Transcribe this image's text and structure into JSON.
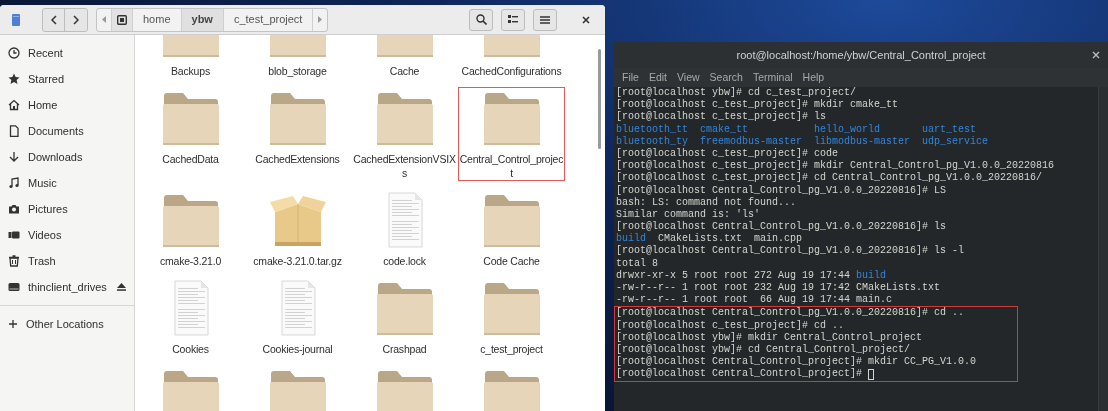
{
  "file_manager": {
    "path": [
      {
        "label": "home",
        "selected": false
      },
      {
        "label": "ybw",
        "selected": true
      },
      {
        "label": "c_test_project",
        "selected": false
      }
    ],
    "sidebar": {
      "items": [
        {
          "kind": "recent",
          "label": "Recent",
          "ejectable": false
        },
        {
          "kind": "starred",
          "label": "Starred",
          "ejectable": false
        },
        {
          "kind": "home",
          "label": "Home",
          "ejectable": false
        },
        {
          "kind": "documents",
          "label": "Documents",
          "ejectable": false
        },
        {
          "kind": "downloads",
          "label": "Downloads",
          "ejectable": false
        },
        {
          "kind": "music",
          "label": "Music",
          "ejectable": false
        },
        {
          "kind": "pictures",
          "label": "Pictures",
          "ejectable": false
        },
        {
          "kind": "videos",
          "label": "Videos",
          "ejectable": false
        },
        {
          "kind": "trash",
          "label": "Trash",
          "ejectable": false
        },
        {
          "kind": "drive",
          "label": "thinclient_drives",
          "ejectable": true
        }
      ],
      "other_locations": "Other Locations"
    },
    "files": [
      {
        "kind": "folder",
        "name": "Backups",
        "selected": false
      },
      {
        "kind": "folder",
        "name": "blob_storage",
        "selected": false
      },
      {
        "kind": "folder",
        "name": "Cache",
        "selected": false
      },
      {
        "kind": "folder",
        "name": "CachedConfigurations",
        "selected": false
      },
      {
        "kind": "folder",
        "name": "CachedData",
        "selected": false
      },
      {
        "kind": "folder",
        "name": "CachedExtensions",
        "selected": false
      },
      {
        "kind": "folder",
        "name": "CachedExtensionVSIXs",
        "selected": false
      },
      {
        "kind": "folder",
        "name": "Central_Control_project",
        "selected": true
      },
      {
        "kind": "folder",
        "name": "cmake-3.21.0",
        "selected": false
      },
      {
        "kind": "archive",
        "name": "cmake-3.21.0.tar.gz",
        "selected": false
      },
      {
        "kind": "document",
        "name": "code.lock",
        "selected": false
      },
      {
        "kind": "folder",
        "name": "Code Cache",
        "selected": false
      },
      {
        "kind": "document",
        "name": "Cookies",
        "selected": false
      },
      {
        "kind": "document",
        "name": "Cookies-journal",
        "selected": false
      },
      {
        "kind": "folder",
        "name": "Crashpad",
        "selected": false
      },
      {
        "kind": "folder",
        "name": "c_test_project",
        "selected": false
      },
      {
        "kind": "folder",
        "selected": false
      },
      {
        "kind": "folder",
        "selected": false
      },
      {
        "kind": "folder",
        "selected": false
      },
      {
        "kind": "folder",
        "selected": false
      }
    ]
  },
  "terminal": {
    "title": "root@localhost:/home/ybw/Central_Control_project",
    "menu": [
      "File",
      "Edit",
      "View",
      "Search",
      "Terminal",
      "Help"
    ],
    "lines": [
      {
        "highlighted": false,
        "segments": [
          {
            "kind": "plain",
            "text": "[root@localhost ybw]# cd c_test_project/"
          }
        ]
      },
      {
        "highlighted": false,
        "segments": [
          {
            "kind": "plain",
            "text": "[root@localhost c_test_project]# mkdir cmake_tt"
          }
        ]
      },
      {
        "highlighted": false,
        "segments": [
          {
            "kind": "plain",
            "text": "[root@localhost c_test_project]# ls"
          }
        ]
      },
      {
        "highlighted": false,
        "kind": "listing",
        "segments": [
          {
            "kind": "dir",
            "text": "bluetooth_tt"
          },
          {
            "kind": "dir",
            "text": "cmake_tt"
          },
          {
            "kind": "dir",
            "text": "hello_world"
          },
          {
            "kind": "dir",
            "text": "uart_test"
          }
        ]
      },
      {
        "highlighted": false,
        "kind": "listing",
        "segments": [
          {
            "kind": "dir",
            "text": "bluetooth_ty"
          },
          {
            "kind": "dir",
            "text": "freemodbus-master"
          },
          {
            "kind": "dir",
            "text": "libmodbus-master"
          },
          {
            "kind": "dir",
            "text": "udp_service"
          }
        ]
      },
      {
        "highlighted": false,
        "segments": [
          {
            "kind": "plain",
            "text": "[root@localhost c_test_project]# code"
          }
        ]
      },
      {
        "highlighted": false,
        "segments": [
          {
            "kind": "plain",
            "text": "[root@localhost c_test_project]# mkdir Central_Control_pg_V1.0.0_20220816"
          }
        ]
      },
      {
        "highlighted": false,
        "segments": [
          {
            "kind": "plain",
            "text": "[root@localhost c_test_project]# cd Central_Control_pg_V1.0.0_20220816/"
          }
        ]
      },
      {
        "highlighted": false,
        "segments": [
          {
            "kind": "plain",
            "text": "[root@localhost Central_Control_pg_V1.0.0_20220816]# LS"
          }
        ]
      },
      {
        "highlighted": false,
        "segments": [
          {
            "kind": "plain",
            "text": "bash: LS: command not found..."
          }
        ]
      },
      {
        "highlighted": false,
        "segments": [
          {
            "kind": "plain",
            "text": "Similar command is: 'ls'"
          }
        ]
      },
      {
        "highlighted": false,
        "segments": [
          {
            "kind": "plain",
            "text": "[root@localhost Central_Control_pg_V1.0.0_20220816]# ls"
          }
        ]
      },
      {
        "highlighted": false,
        "kind": "listing",
        "segments": [
          {
            "kind": "dir",
            "text": "build"
          },
          {
            "kind": "plain",
            "text": "CMakeLists.txt"
          },
          {
            "kind": "plain",
            "text": "main.cpp"
          }
        ]
      },
      {
        "highlighted": false,
        "segments": [
          {
            "kind": "plain",
            "text": "[root@localhost Central_Control_pg_V1.0.0_20220816]# ls -l"
          }
        ]
      },
      {
        "highlighted": false,
        "segments": [
          {
            "kind": "plain",
            "text": "total 8"
          }
        ]
      },
      {
        "highlighted": false,
        "segments": [
          {
            "kind": "plain",
            "text": "drwxr-xr-x 5 root root 272 Aug 19 17:44 "
          },
          {
            "kind": "dir",
            "text": "build"
          }
        ]
      },
      {
        "highlighted": false,
        "segments": [
          {
            "kind": "plain",
            "text": "-rw-r--r-- 1 root root 232 Aug 19 17:42 CMakeLists.txt"
          }
        ]
      },
      {
        "highlighted": false,
        "segments": [
          {
            "kind": "plain",
            "text": "-rw-r--r-- 1 root root  66 Aug 19 17:44 main.c"
          }
        ]
      },
      {
        "highlighted": true,
        "segments": [
          {
            "kind": "plain",
            "text": "[root@localhost Central_Control_pg_V1.0.0_20220816]# cd .."
          }
        ]
      },
      {
        "highlighted": true,
        "segments": [
          {
            "kind": "plain",
            "text": "[root@localhost c_test_project]# cd .."
          }
        ]
      },
      {
        "highlighted": true,
        "segments": [
          {
            "kind": "plain",
            "text": "[root@localhost ybw]# mkdir Central_Control_project"
          }
        ]
      },
      {
        "highlighted": true,
        "segments": [
          {
            "kind": "plain",
            "text": "[root@localhost ybw]# cd Central_Control_project/"
          }
        ]
      },
      {
        "highlighted": true,
        "segments": [
          {
            "kind": "plain",
            "text": "[root@localhost Central_Control_project]# mkdir CC_PG_V1.0.0"
          }
        ]
      },
      {
        "highlighted": true,
        "segments": [
          {
            "kind": "plain",
            "text": "[root@localhost Central_Control_project]# "
          }
        ]
      }
    ]
  }
}
